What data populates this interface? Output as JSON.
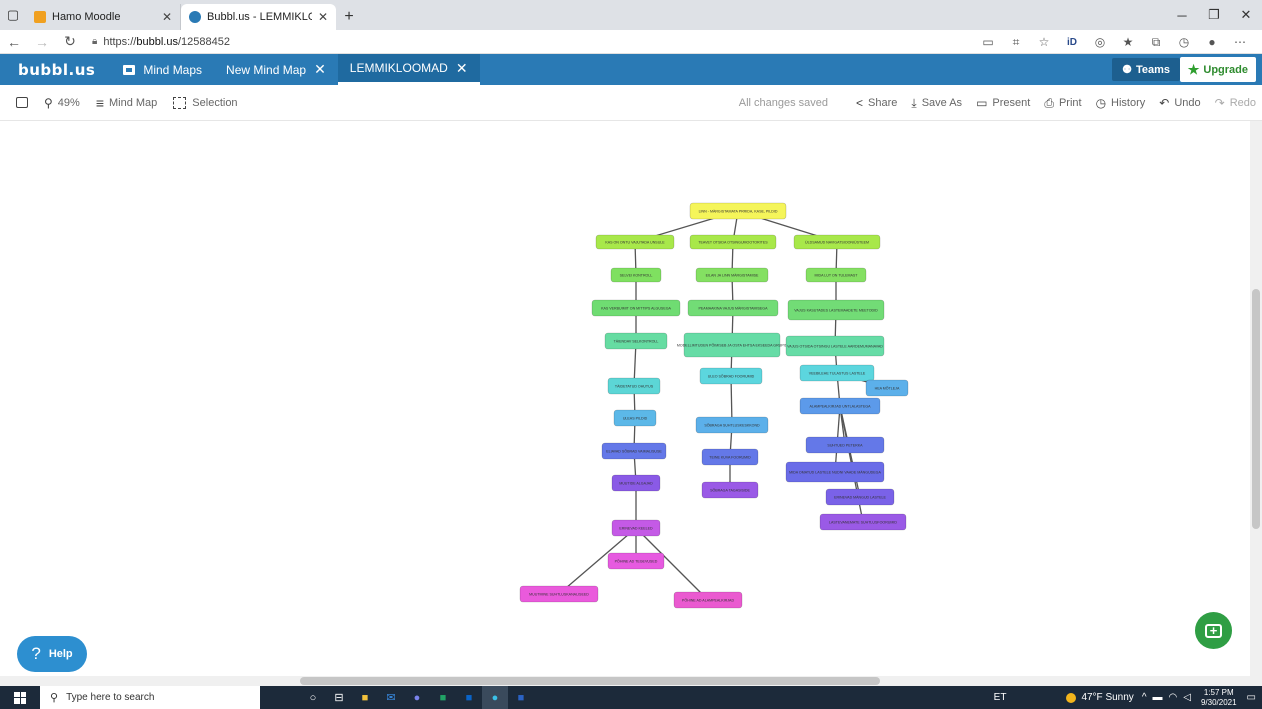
{
  "browser": {
    "tabs": [
      {
        "title": "Hamo Moodle",
        "active": false,
        "favicon_color": "#f0a020"
      },
      {
        "title": "Bubbl.us - LEMMIKLOOMAD",
        "active": true,
        "favicon_color": "#2a7ab5"
      }
    ],
    "url_prefix": "https://",
    "url_host": "bubbl.us",
    "url_path": "/12588452"
  },
  "app": {
    "logo": "bubbl.us",
    "tabs": [
      {
        "label": "Mind Maps"
      },
      {
        "label": "New Mind Map"
      },
      {
        "label": "LEMMIKLOOMAD"
      }
    ],
    "teams_label": "Teams",
    "upgrade_label": "Upgrade"
  },
  "toolbar": {
    "zoom": "49%",
    "mind_map": "Mind Map",
    "selection": "Selection",
    "status": "All changes saved",
    "share": "Share",
    "save_as": "Save As",
    "present": "Present",
    "print": "Print",
    "history": "History",
    "undo": "Undo",
    "redo": "Redo"
  },
  "mindmap": {
    "nodes": [
      {
        "id": "root",
        "text": "LINN - MÄRGISTAMATA PRRIDA, KASE, PILDID",
        "color": "#f5f55a"
      },
      {
        "id": "a1",
        "text": "KAS ON ONTU VAJUTADA UNSULE",
        "color": "#a8e84a"
      },
      {
        "id": "a2",
        "text": "SELVEI KONTROLL",
        "color": "#7fe060"
      },
      {
        "id": "a3",
        "text": "KAS VERBUIMIT ON MITTIPS ALGUSEGA",
        "color": "#6fdc72"
      },
      {
        "id": "a4",
        "text": "TÄIENDAV SELKONTROLL",
        "color": "#66dca2"
      },
      {
        "id": "a5",
        "text": "TÄIDETATUD OHUTUS",
        "color": "#5cd6d6"
      },
      {
        "id": "a6",
        "text": "ULEAS PILDID",
        "color": "#5cb8e8"
      },
      {
        "id": "a7",
        "text": "ELIAVAD SÕBRAD VAIMALISUSE",
        "color": "#6478e8"
      },
      {
        "id": "a8",
        "text": "MUUTIDE ALGAJAD",
        "color": "#8a5ae6"
      },
      {
        "id": "a9",
        "text": "ERINEVAD KEELED",
        "color": "#c45ae6"
      },
      {
        "id": "a10",
        "text": "PÕHINE AD TEGEVUSED",
        "color": "#e65ae0"
      },
      {
        "id": "a11",
        "text": "MUUTMINE SUHTLUSKANALISEED",
        "color": "#ea5adc"
      },
      {
        "id": "a12",
        "text": "PÕHINE AD ALAMPEALKIRJAD",
        "color": "#ea5ad0"
      },
      {
        "id": "b1",
        "text": "TEAVET OTSIDA OTSINGUMOOTORITES",
        "color": "#a8e84a"
      },
      {
        "id": "b2",
        "text": "EILAN JA LINN MÄRGISTAMISE",
        "color": "#84e062"
      },
      {
        "id": "b3",
        "text": "PEAMAAKINA VAJUS MÄRGISTAMISEGA",
        "color": "#72dc76"
      },
      {
        "id": "b4",
        "text": "MODELLIMTUDEN PÕIMISEB JA OSTA EHTSA EKSEEDA GRUPIS",
        "color": "#66dca6"
      },
      {
        "id": "b5",
        "text": "ULEO SÕBRAD FOORUMID",
        "color": "#5cd6de"
      },
      {
        "id": "b6",
        "text": "SÕBRAGA SUHTLUSKESKKOND",
        "color": "#5cb0ea"
      },
      {
        "id": "b7",
        "text": "TEINE KUVA FOORUMID",
        "color": "#6478e8"
      },
      {
        "id": "b8",
        "text": "SÕBRAGA TAGASISIDE",
        "color": "#9a5ae6"
      },
      {
        "id": "c1",
        "text": "ÜLDSAMUD NAVIGATSIOONIÜSTEEM",
        "color": "#a8e84a"
      },
      {
        "id": "c2",
        "text": "MIDA LUT ON TULEMAST",
        "color": "#84e062"
      },
      {
        "id": "c3",
        "text": "VAJUS KASUTADES LASTEMAADETE MEETODID",
        "color": "#72dc76"
      },
      {
        "id": "c4",
        "text": "VAJUS OTSIDA OTSINGU LASTELE AARDEMUMANAVAD",
        "color": "#66dca6"
      },
      {
        "id": "c5",
        "text": "VEEBILEHE TULASTUS LASTELE",
        "color": "#5cd6de"
      },
      {
        "id": "c6",
        "text": "HEA MÕTLEJA",
        "color": "#5cb0ea"
      },
      {
        "id": "c7",
        "text": "ALAMPEALKIRJAD UNTLALASTEGA",
        "color": "#5c9aea"
      },
      {
        "id": "c8",
        "text": "SUHTUED PETERKA",
        "color": "#6478e8"
      },
      {
        "id": "c9",
        "text": "MIDA OMATUD LASTELE NUDNI VAADE MÄNGUDEGA",
        "color": "#6a6ce8"
      },
      {
        "id": "c10",
        "text": "ERINEVAD MÄNGUD LASTELE",
        "color": "#7a62e8"
      },
      {
        "id": "c11",
        "text": "LASTEVANEMATE SUHTLUSFOORUMID",
        "color": "#9a5ae6"
      }
    ]
  },
  "help_label": "Help",
  "taskbar": {
    "search_placeholder": "Type here to search",
    "language": "ET",
    "weather": "47°F  Sunny",
    "time": "1:57 PM",
    "date": "9/30/2021"
  }
}
